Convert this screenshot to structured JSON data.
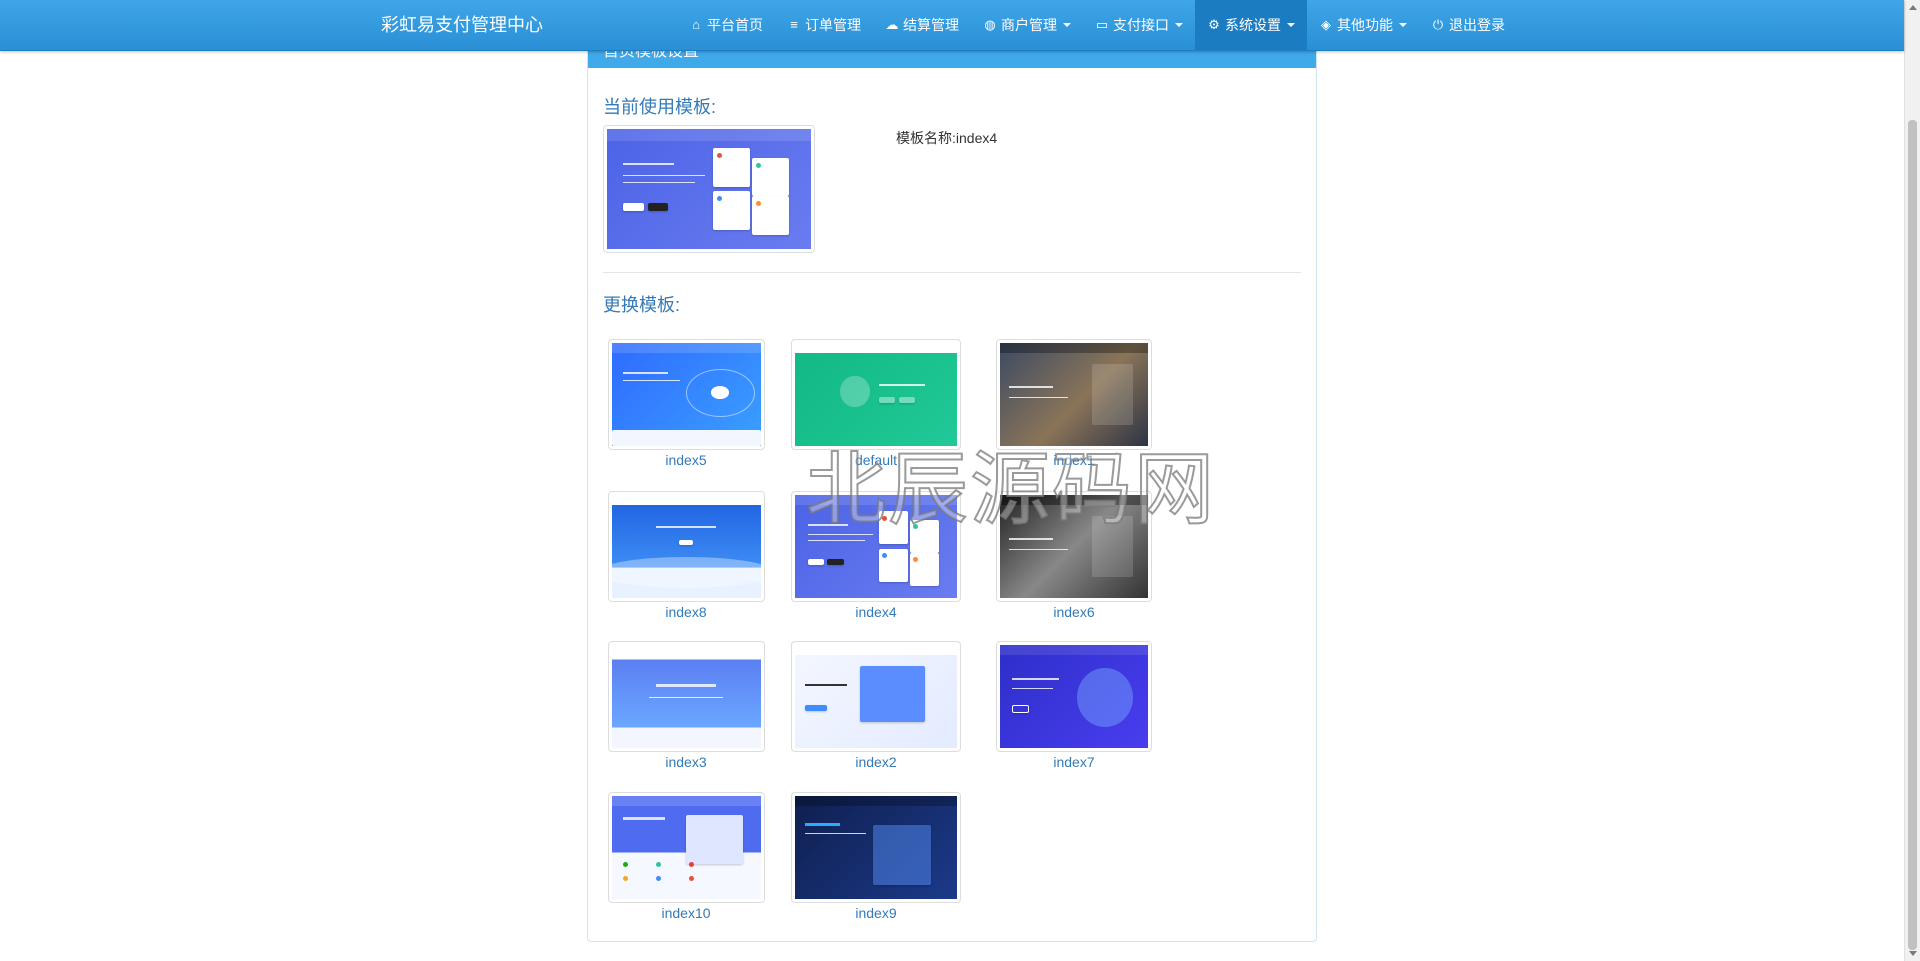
{
  "navbar": {
    "brand": "彩虹易支付管理中心",
    "items": [
      {
        "label": "平台首页",
        "icon": "home-icon",
        "glyph": "⌂"
      },
      {
        "label": "订单管理",
        "icon": "list-icon",
        "glyph": "≡"
      },
      {
        "label": "结算管理",
        "icon": "cloud-icon",
        "glyph": "☁"
      },
      {
        "label": "商户管理",
        "icon": "user-icon",
        "glyph": "◍",
        "dropdown": true
      },
      {
        "label": "支付接口",
        "icon": "credit-card-icon",
        "glyph": "▭",
        "dropdown": true
      },
      {
        "label": "系统设置",
        "icon": "gear-icon",
        "glyph": "⚙",
        "dropdown": true,
        "active": true
      },
      {
        "label": "其他功能",
        "icon": "cube-icon",
        "glyph": "◈",
        "dropdown": true
      },
      {
        "label": "退出登录",
        "icon": "power-icon",
        "glyph": "⏻"
      }
    ]
  },
  "panel": {
    "heading": "首页模板设置",
    "current_title": "当前使用模板:",
    "current_name_label": "模板名称:index4",
    "change_title": "更换模板:"
  },
  "templates": [
    {
      "name": "index5",
      "style": "blue-orbit"
    },
    {
      "name": "default",
      "style": "green-cart"
    },
    {
      "name": "index1",
      "style": "city-night"
    },
    {
      "name": "index8",
      "style": "blue-wave"
    },
    {
      "name": "index4",
      "style": "indigo-cards"
    },
    {
      "name": "index6",
      "style": "bw-photo"
    },
    {
      "name": "index3",
      "style": "light-banner"
    },
    {
      "name": "index2",
      "style": "isometric-light"
    },
    {
      "name": "index7",
      "style": "purple-iso"
    },
    {
      "name": "index10",
      "style": "payment-laptop"
    },
    {
      "name": "index9",
      "style": "dark-navy"
    }
  ],
  "watermark": "北辰源码网",
  "colors": {
    "navbar": "#3fa6e7",
    "navbar_active": "#1c7cc2",
    "link": "#337ab7",
    "panel_heading": "#3fa9ea"
  }
}
